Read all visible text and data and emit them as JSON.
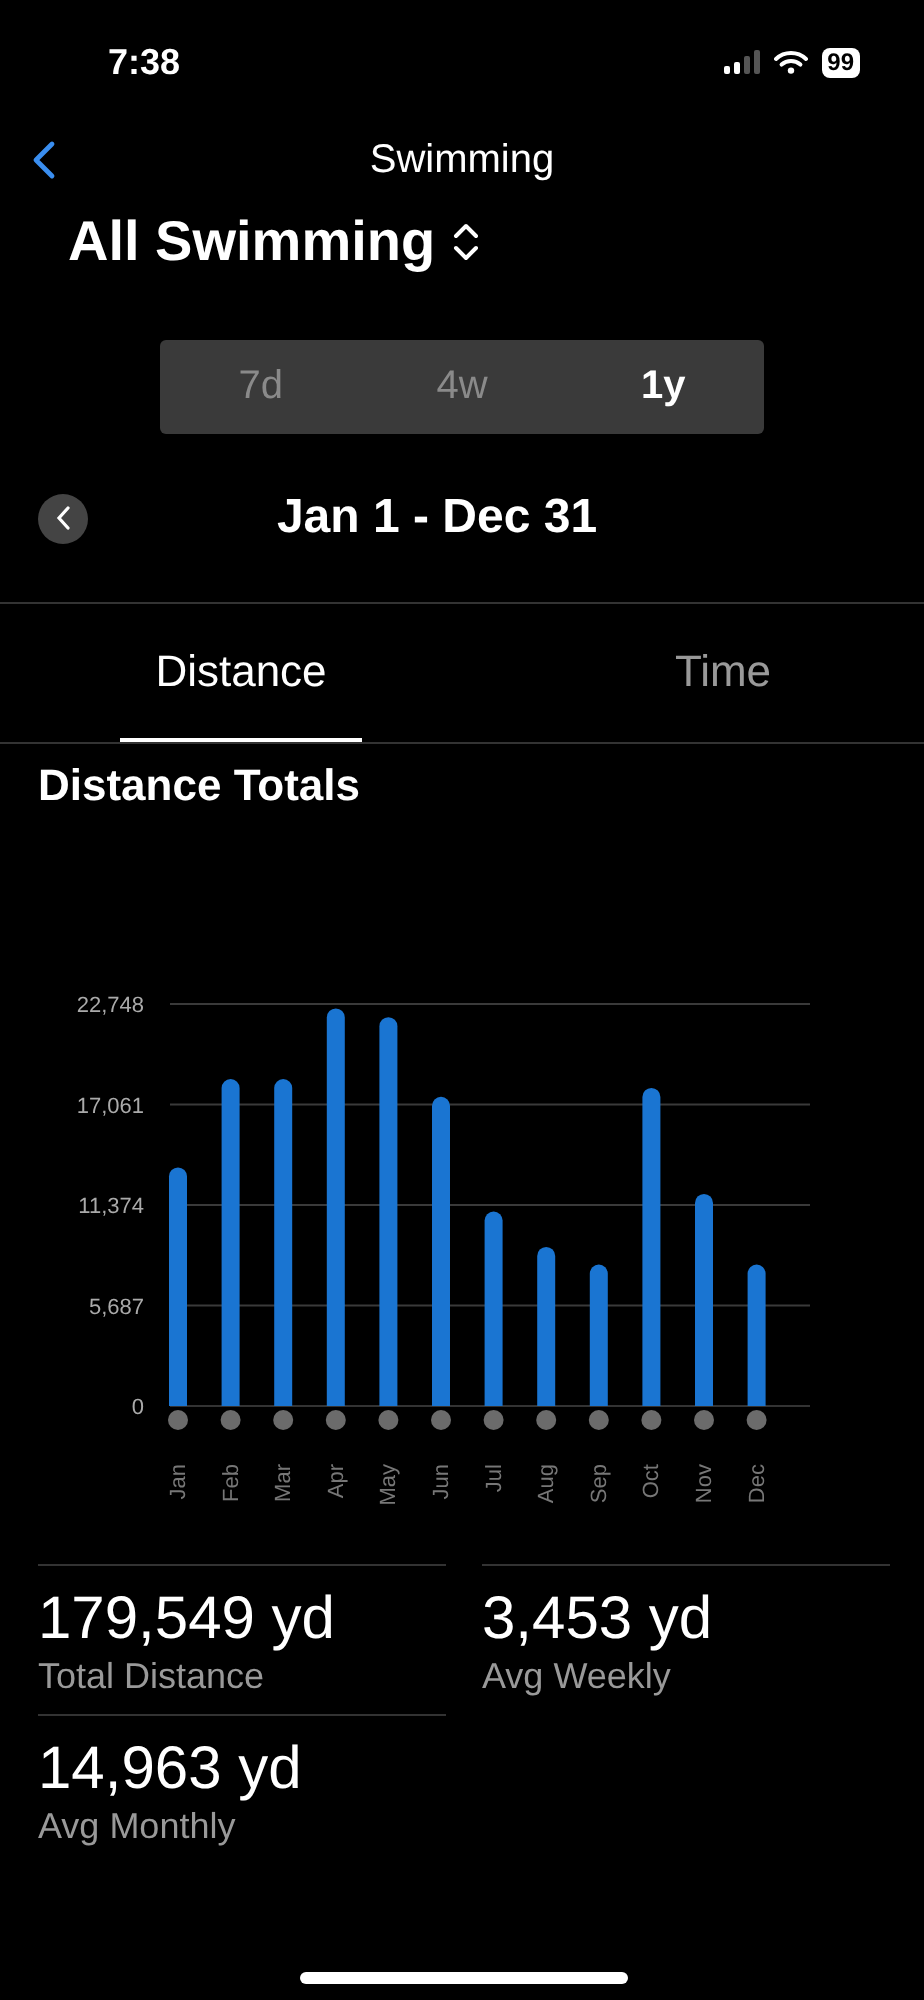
{
  "status_bar": {
    "time": "7:38",
    "battery": "99"
  },
  "nav": {
    "title": "Swimming"
  },
  "filter": {
    "label": "All Swimming"
  },
  "range_tabs": [
    {
      "label": "7d",
      "selected": false
    },
    {
      "label": "4w",
      "selected": false
    },
    {
      "label": "1y",
      "selected": true
    }
  ],
  "period": {
    "label": "Jan 1 - Dec 31"
  },
  "metric_tabs": [
    {
      "label": "Distance",
      "selected": true
    },
    {
      "label": "Time",
      "selected": false
    }
  ],
  "section": {
    "title": "Distance Totals",
    "chart_data": {
      "type": "bar",
      "categories": [
        "Jan",
        "Feb",
        "Mar",
        "Apr",
        "May",
        "Jun",
        "Jul",
        "Aug",
        "Sep",
        "Oct",
        "Nov",
        "Dec"
      ],
      "series": [
        {
          "color": "#1a75d2",
          "values": [
            13500,
            18500,
            18500,
            22500,
            22000,
            17500,
            11000,
            9000,
            8000,
            18000,
            12000,
            8000
          ]
        }
      ],
      "grid": true,
      "ylim": [
        0,
        22748
      ],
      "yticks": [
        {
          "value": 0,
          "label": "0"
        },
        {
          "value": 5687,
          "label": "5,687"
        },
        {
          "value": 11374,
          "label": "11,374"
        },
        {
          "value": 17061,
          "label": "17,061"
        },
        {
          "value": 22748,
          "label": "22,748"
        }
      ]
    }
  },
  "stats": [
    {
      "value": "179,549 yd",
      "label": "Total Distance"
    },
    {
      "value": "3,453 yd",
      "label": "Avg Weekly"
    },
    {
      "value": "14,963 yd",
      "label": "Avg Monthly"
    }
  ]
}
